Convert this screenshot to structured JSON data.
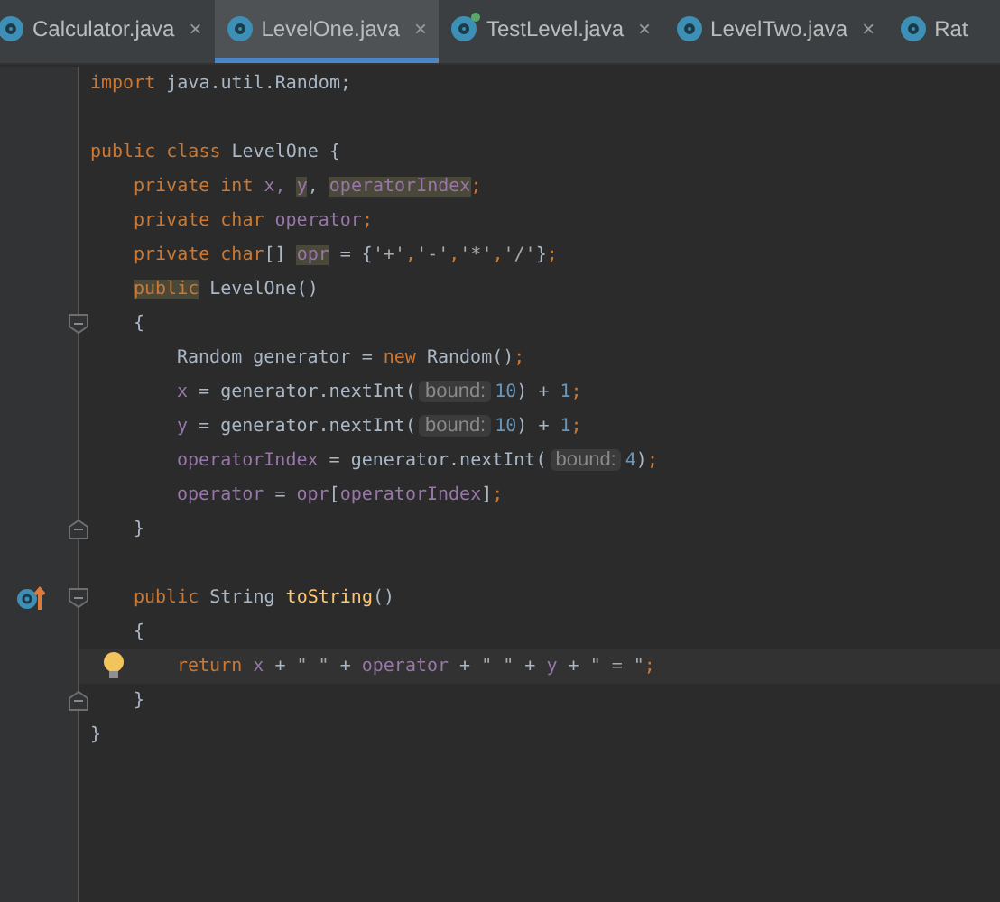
{
  "tabs": [
    {
      "label": "Calculator.java",
      "selected": false,
      "close": true,
      "badge": false
    },
    {
      "label": "LevelOne.java",
      "selected": true,
      "close": true,
      "badge": false
    },
    {
      "label": "TestLevel.java",
      "selected": false,
      "close": true,
      "badge": true
    },
    {
      "label": "LevelTwo.java",
      "selected": false,
      "close": true,
      "badge": false
    },
    {
      "label": "Rat",
      "selected": false,
      "close": false,
      "badge": false
    }
  ],
  "close_symbol": "×",
  "lines": [
    {
      "fold_start": false,
      "fold_end": false,
      "override": false,
      "bulb": false,
      "current": false,
      "tokens": [
        {
          "kind": "kw",
          "text": "import"
        },
        {
          "kind": "plain",
          "text": " java.util.Random;"
        }
      ]
    },
    {
      "fold_start": false,
      "fold_end": false,
      "override": false,
      "bulb": false,
      "current": false
    },
    {
      "fold_start": false,
      "fold_end": false,
      "override": false,
      "bulb": false,
      "current": false,
      "tokens": [
        {
          "kind": "kw",
          "text": "public class"
        },
        {
          "kind": "plain",
          "text": " LevelOne {"
        }
      ],
      "children": [
        {
          "fold_start": false,
          "fold_end": false,
          "override": false,
          "bulb": false,
          "current": false,
          "tokens": [
            {
              "kind": "kw",
              "text": "private int"
            },
            {
              "kind": "field",
              "text": " x, "
            },
            {
              "kind": "field",
              "text": "y",
              "highlight": true
            },
            {
              "kind": "plain",
              "text": ", "
            },
            {
              "kind": "field",
              "text": "operatorIndex",
              "highlight": true
            },
            {
              "kind": "kw",
              "text": ";"
            }
          ]
        },
        {
          "fold_start": false,
          "fold_end": false,
          "override": false,
          "bulb": false,
          "current": false,
          "tokens": [
            {
              "kind": "kw",
              "text": "private char"
            },
            {
              "kind": "field",
              "text": " operator"
            },
            {
              "kind": "kw",
              "text": ";"
            }
          ]
        },
        {
          "fold_start": false,
          "fold_end": false,
          "override": false,
          "bulb": false,
          "current": false,
          "tokens": [
            {
              "kind": "kw",
              "text": "private char"
            },
            {
              "kind": "plain",
              "text": "[] "
            },
            {
              "kind": "field",
              "text": "opr",
              "highlight": true
            },
            {
              "kind": "plain",
              "text": " = {"
            },
            {
              "kind": "str",
              "text": "'+'"
            },
            {
              "kind": "kw",
              "text": ","
            },
            {
              "kind": "str",
              "text": "'-'"
            },
            {
              "kind": "kw",
              "text": ","
            },
            {
              "kind": "str",
              "text": "'*'"
            },
            {
              "kind": "kw",
              "text": ","
            },
            {
              "kind": "str",
              "text": "'/'"
            },
            {
              "kind": "plain",
              "text": "}"
            },
            {
              "kind": "kw",
              "text": ";"
            }
          ]
        },
        {
          "fold_start": false,
          "fold_end": false,
          "override": false,
          "bulb": false,
          "current": false,
          "tokens": [
            {
              "kind": "kw",
              "text": "public",
              "highlight": true
            },
            {
              "kind": "plain",
              "text": " LevelOne()"
            }
          ]
        },
        {
          "fold_start": true,
          "fold_end": false,
          "override": false,
          "bulb": false,
          "current": false,
          "tokens": [
            {
              "kind": "plain",
              "text": "{"
            }
          ],
          "children": [
            {
              "fold_start": false,
              "fold_end": false,
              "override": false,
              "bulb": false,
              "current": false,
              "tokens": [
                {
                  "kind": "plain",
                  "text": "Random generator = "
                },
                {
                  "kind": "kw",
                  "text": "new"
                },
                {
                  "kind": "plain",
                  "text": " Random()"
                },
                {
                  "kind": "kw",
                  "text": ";"
                }
              ]
            },
            {
              "fold_start": false,
              "fold_end": false,
              "override": false,
              "bulb": false,
              "current": false,
              "tokens": [
                {
                  "kind": "field",
                  "text": "x"
                },
                {
                  "kind": "plain",
                  "text": " = generator.nextInt("
                },
                {
                  "kind": "hint",
                  "text": "bound:"
                },
                {
                  "kind": "num",
                  "text": "10"
                },
                {
                  "kind": "plain",
                  "text": ") + "
                },
                {
                  "kind": "num",
                  "text": "1"
                },
                {
                  "kind": "kw",
                  "text": ";"
                }
              ]
            },
            {
              "fold_start": false,
              "fold_end": false,
              "override": false,
              "bulb": false,
              "current": false,
              "tokens": [
                {
                  "kind": "field",
                  "text": "y"
                },
                {
                  "kind": "plain",
                  "text": " = generator.nextInt("
                },
                {
                  "kind": "hint",
                  "text": "bound:"
                },
                {
                  "kind": "num",
                  "text": "10"
                },
                {
                  "kind": "plain",
                  "text": ") + "
                },
                {
                  "kind": "num",
                  "text": "1"
                },
                {
                  "kind": "kw",
                  "text": ";"
                }
              ]
            },
            {
              "fold_start": false,
              "fold_end": false,
              "override": false,
              "bulb": false,
              "current": false,
              "tokens": [
                {
                  "kind": "field",
                  "text": "operatorIndex"
                },
                {
                  "kind": "plain",
                  "text": " = generator.nextInt("
                },
                {
                  "kind": "hint",
                  "text": "bound:"
                },
                {
                  "kind": "num",
                  "text": "4"
                },
                {
                  "kind": "plain",
                  "text": ")"
                },
                {
                  "kind": "kw",
                  "text": ";"
                }
              ]
            },
            {
              "fold_start": false,
              "fold_end": false,
              "override": false,
              "bulb": false,
              "current": false,
              "tokens": [
                {
                  "kind": "field",
                  "text": "operator"
                },
                {
                  "kind": "plain",
                  "text": " = "
                },
                {
                  "kind": "field",
                  "text": "opr"
                },
                {
                  "kind": "plain",
                  "text": "["
                },
                {
                  "kind": "field",
                  "text": "operatorIndex"
                },
                {
                  "kind": "plain",
                  "text": "]"
                },
                {
                  "kind": "kw",
                  "text": ";"
                }
              ]
            }
          ]
        },
        {
          "fold_start": false,
          "fold_end": true,
          "override": false,
          "bulb": false,
          "current": false,
          "tokens": [
            {
              "kind": "plain",
              "text": "}"
            }
          ]
        },
        {
          "fold_start": false,
          "fold_end": false,
          "override": false,
          "bulb": false,
          "current": false
        },
        {
          "fold_start": true,
          "fold_end": false,
          "override": true,
          "bulb": false,
          "current": false,
          "tokens": [
            {
              "kind": "kw",
              "text": "public"
            },
            {
              "kind": "plain",
              "text": " String "
            },
            {
              "kind": "method",
              "text": "toString"
            },
            {
              "kind": "plain",
              "text": "()"
            }
          ]
        },
        {
          "fold_start": false,
          "fold_end": false,
          "override": false,
          "bulb": false,
          "current": false,
          "tokens": [
            {
              "kind": "plain",
              "text": "{"
            }
          ],
          "children": [
            {
              "fold_start": false,
              "fold_end": false,
              "override": false,
              "bulb": true,
              "current": true,
              "tokens": [
                {
                  "kind": "kw",
                  "text": "return"
                },
                {
                  "kind": "field",
                  "text": " x"
                },
                {
                  "kind": "plain",
                  "text": " + "
                },
                {
                  "kind": "str",
                  "text": "\" \""
                },
                {
                  "kind": "plain",
                  "text": " + "
                },
                {
                  "kind": "field",
                  "text": "operator"
                },
                {
                  "kind": "plain",
                  "text": " + "
                },
                {
                  "kind": "str",
                  "text": "\" \""
                },
                {
                  "kind": "plain",
                  "text": " + "
                },
                {
                  "kind": "field",
                  "text": "y"
                },
                {
                  "kind": "plain",
                  "text": " + "
                },
                {
                  "kind": "str",
                  "text": "\" = \""
                },
                {
                  "kind": "kw",
                  "text": ";"
                }
              ]
            }
          ]
        },
        {
          "fold_start": false,
          "fold_end": true,
          "override": false,
          "bulb": false,
          "current": false,
          "tokens": [
            {
              "kind": "plain",
              "text": "}"
            }
          ]
        }
      ]
    },
    {
      "fold_start": false,
      "fold_end": false,
      "override": false,
      "bulb": false,
      "current": false,
      "tokens": [
        {
          "kind": "plain",
          "text": "}"
        }
      ]
    }
  ]
}
